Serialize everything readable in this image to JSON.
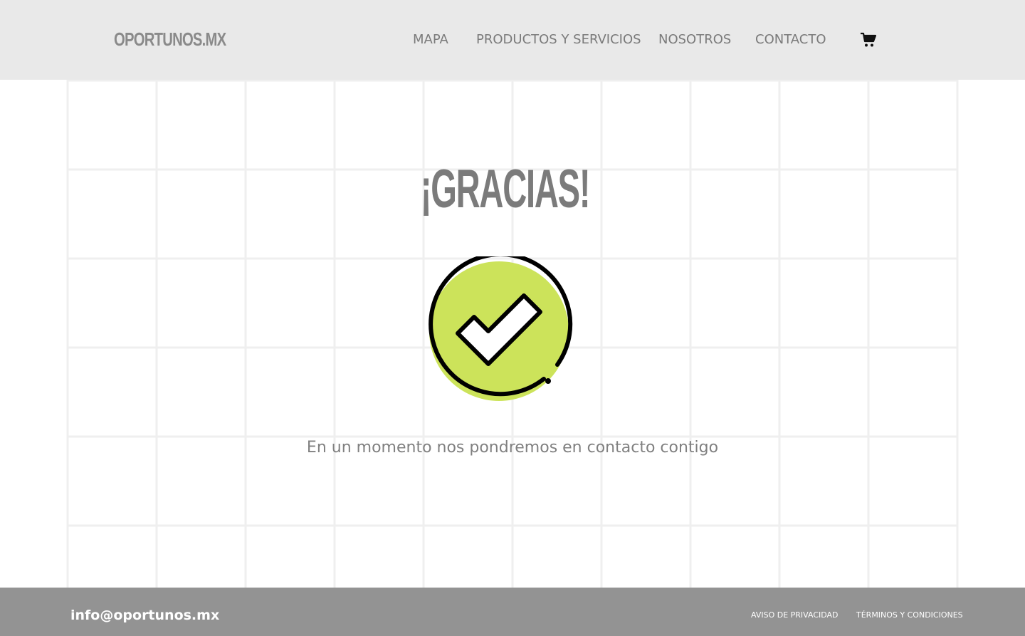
{
  "header": {
    "logo": "OPORTUNOS.MX",
    "nav": [
      {
        "label": "MAPA"
      },
      {
        "label": "PRODUCTOS Y SERVICIOS"
      },
      {
        "label": "NOSOTROS"
      },
      {
        "label": "CONTACTO"
      }
    ],
    "cart_icon": "shopping-cart-icon"
  },
  "main": {
    "title": "¡GRACIAS!",
    "icon": "check-circle-icon",
    "message": "En un momento nos pondremos en contacto contigo"
  },
  "footer": {
    "email": "info@oportunos.mx",
    "links": [
      {
        "label": "AVISO DE PRIVACIDAD"
      },
      {
        "label": "TÉRMINOS Y CONDICIONES"
      }
    ]
  },
  "colors": {
    "header_bg": "#e9e9e9",
    "footer_bg": "#939393",
    "check_green": "#cce35a",
    "text_gray": "#7b7b7b"
  }
}
